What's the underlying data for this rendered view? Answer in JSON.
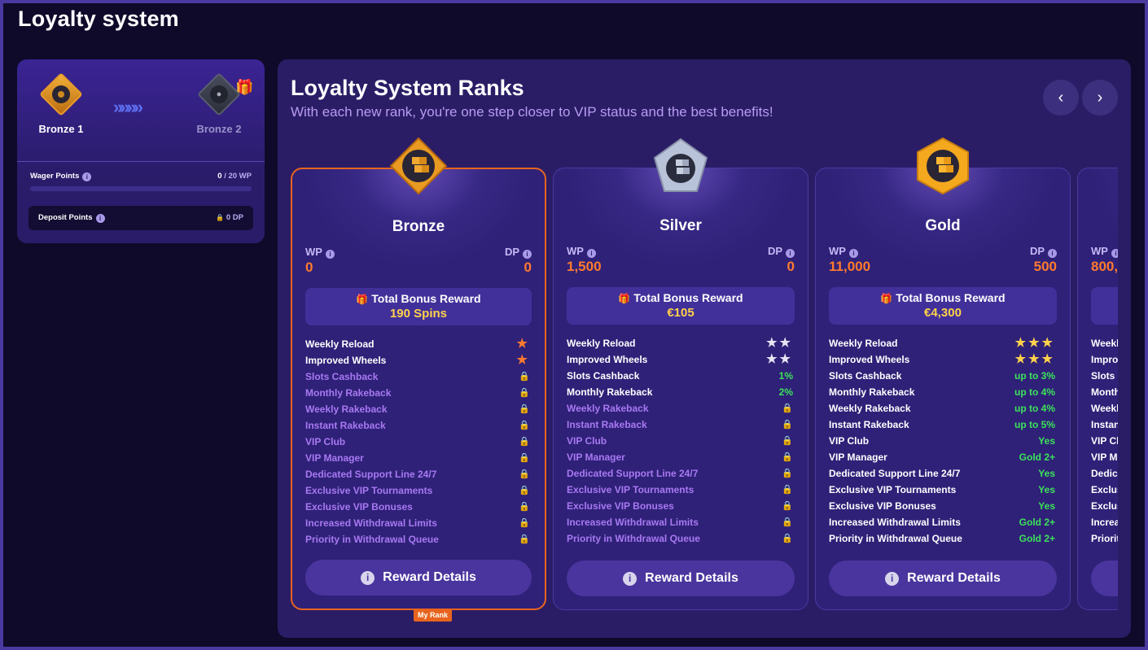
{
  "page": {
    "title": "Loyalty system"
  },
  "progress": {
    "current_rank": "Bronze 1",
    "next_rank": "Bronze 2",
    "wager_label": "Wager Points",
    "wager_current": "0",
    "wager_suffix": " / 20 WP",
    "wager_fraction": 0,
    "deposit_label": "Deposit Points",
    "deposit_value": "0 DP"
  },
  "ranks": {
    "title": "Loyalty System Ranks",
    "subtitle": "With each new rank, you're one step closer to VIP status and the best benefits!",
    "my_rank_label": "My Rank",
    "bonus_title": "Total Bonus Reward",
    "reward_button": "Reward Details",
    "wp_label": "WP",
    "dp_label": "DP",
    "cards": [
      {
        "name": "Bronze",
        "wp": "0",
        "dp": "0",
        "bonus": "190 Spins",
        "features": [
          {
            "label": "Weekly Reload",
            "value": "★",
            "kind": "stars",
            "color": "#ff7a2e",
            "locked": false
          },
          {
            "label": "Improved Wheels",
            "value": "★",
            "kind": "stars",
            "color": "#ff7a2e",
            "locked": false
          },
          {
            "label": "Slots Cashback",
            "value": "🔒",
            "kind": "lock",
            "locked": true
          },
          {
            "label": "Monthly Rakeback",
            "value": "🔒",
            "kind": "lock",
            "locked": true
          },
          {
            "label": "Weekly Rakeback",
            "value": "🔒",
            "kind": "lock",
            "locked": true
          },
          {
            "label": "Instant Rakeback",
            "value": "🔒",
            "kind": "lock",
            "locked": true
          },
          {
            "label": "VIP Club",
            "value": "🔒",
            "kind": "lock",
            "locked": true
          },
          {
            "label": "VIP Manager",
            "value": "🔒",
            "kind": "lock",
            "locked": true
          },
          {
            "label": "Dedicated Support Line 24/7",
            "value": "🔒",
            "kind": "lock",
            "locked": true
          },
          {
            "label": "Exclusive VIP Tournaments",
            "value": "🔒",
            "kind": "lock",
            "locked": true
          },
          {
            "label": "Exclusive VIP Bonuses",
            "value": "🔒",
            "kind": "lock",
            "locked": true
          },
          {
            "label": "Increased Withdrawal Limits",
            "value": "🔒",
            "kind": "lock",
            "locked": true
          },
          {
            "label": "Priority in Withdrawal Queue",
            "value": "🔒",
            "kind": "lock",
            "locked": true
          }
        ]
      },
      {
        "name": "Silver",
        "wp": "1,500",
        "dp": "0",
        "bonus": "€105",
        "features": [
          {
            "label": "Weekly Reload",
            "value": "★★",
            "kind": "stars",
            "color": "#e6e4f2",
            "locked": false
          },
          {
            "label": "Improved Wheels",
            "value": "★★",
            "kind": "stars",
            "color": "#e6e4f2",
            "locked": false
          },
          {
            "label": "Slots Cashback",
            "value": "1%",
            "kind": "green",
            "locked": false
          },
          {
            "label": "Monthly Rakeback",
            "value": "2%",
            "kind": "green",
            "locked": false
          },
          {
            "label": "Weekly Rakeback",
            "value": "🔒",
            "kind": "lock",
            "locked": true
          },
          {
            "label": "Instant Rakeback",
            "value": "🔒",
            "kind": "lock",
            "locked": true
          },
          {
            "label": "VIP Club",
            "value": "🔒",
            "kind": "lock",
            "locked": true
          },
          {
            "label": "VIP Manager",
            "value": "🔒",
            "kind": "lock",
            "locked": true
          },
          {
            "label": "Dedicated Support Line 24/7",
            "value": "🔒",
            "kind": "lock",
            "locked": true
          },
          {
            "label": "Exclusive VIP Tournaments",
            "value": "🔒",
            "kind": "lock",
            "locked": true
          },
          {
            "label": "Exclusive VIP Bonuses",
            "value": "🔒",
            "kind": "lock",
            "locked": true
          },
          {
            "label": "Increased Withdrawal Limits",
            "value": "🔒",
            "kind": "lock",
            "locked": true
          },
          {
            "label": "Priority in Withdrawal Queue",
            "value": "🔒",
            "kind": "lock",
            "locked": true
          }
        ]
      },
      {
        "name": "Gold",
        "wp": "11,000",
        "dp": "500",
        "bonus": "€4,300",
        "features": [
          {
            "label": "Weekly Reload",
            "value": "★★★",
            "kind": "stars",
            "color": "#ffd24a",
            "locked": false
          },
          {
            "label": "Improved Wheels",
            "value": "★★★",
            "kind": "stars",
            "color": "#ffd24a",
            "locked": false
          },
          {
            "label": "Slots Cashback",
            "value": "up to 3%",
            "kind": "green",
            "locked": false
          },
          {
            "label": "Monthly Rakeback",
            "value": "up to 4%",
            "kind": "green",
            "locked": false
          },
          {
            "label": "Weekly Rakeback",
            "value": "up to 4%",
            "kind": "green",
            "locked": false
          },
          {
            "label": "Instant Rakeback",
            "value": "up to 5%",
            "kind": "green",
            "locked": false
          },
          {
            "label": "VIP Club",
            "value": "Yes",
            "kind": "green",
            "locked": false
          },
          {
            "label": "VIP Manager",
            "value": "Gold 2+",
            "kind": "green",
            "locked": false
          },
          {
            "label": "Dedicated Support Line 24/7",
            "value": "Yes",
            "kind": "green",
            "locked": false
          },
          {
            "label": "Exclusive VIP Tournaments",
            "value": "Yes",
            "kind": "green",
            "locked": false
          },
          {
            "label": "Exclusive VIP Bonuses",
            "value": "Yes",
            "kind": "green",
            "locked": false
          },
          {
            "label": "Increased Withdrawal Limits",
            "value": "Gold 2+",
            "kind": "green",
            "locked": false
          },
          {
            "label": "Priority in Withdrawal Queue",
            "value": "Gold 2+",
            "kind": "green",
            "locked": false
          }
        ]
      },
      {
        "name": "",
        "wp": "800,",
        "dp": "",
        "bonus": "",
        "features": [
          {
            "label": "Weekl",
            "value": "",
            "kind": "none",
            "locked": false
          },
          {
            "label": "Impro",
            "value": "",
            "kind": "none",
            "locked": false
          },
          {
            "label": "Slots C",
            "value": "",
            "kind": "none",
            "locked": false
          },
          {
            "label": "Month",
            "value": "",
            "kind": "none",
            "locked": false
          },
          {
            "label": "Weekl",
            "value": "",
            "kind": "none",
            "locked": false
          },
          {
            "label": "Instan",
            "value": "",
            "kind": "none",
            "locked": false
          },
          {
            "label": "VIP Cl",
            "value": "",
            "kind": "none",
            "locked": false
          },
          {
            "label": "VIP M",
            "value": "",
            "kind": "none",
            "locked": false
          },
          {
            "label": "Dedica",
            "value": "",
            "kind": "none",
            "locked": false
          },
          {
            "label": "Exclus",
            "value": "",
            "kind": "none",
            "locked": false
          },
          {
            "label": "Exclus",
            "value": "",
            "kind": "none",
            "locked": false
          },
          {
            "label": "Increa",
            "value": "",
            "kind": "none",
            "locked": false
          },
          {
            "label": "Priorit",
            "value": "",
            "kind": "none",
            "locked": false
          }
        ]
      }
    ]
  },
  "icons": {
    "prev": "‹",
    "next": "›",
    "info": "i",
    "gift": "🎁",
    "arrows": "»»»»",
    "lock": "🔒"
  },
  "colors": {
    "accent_orange": "#e8641e",
    "green": "#3ce35a",
    "gold": "#ffd24a"
  }
}
